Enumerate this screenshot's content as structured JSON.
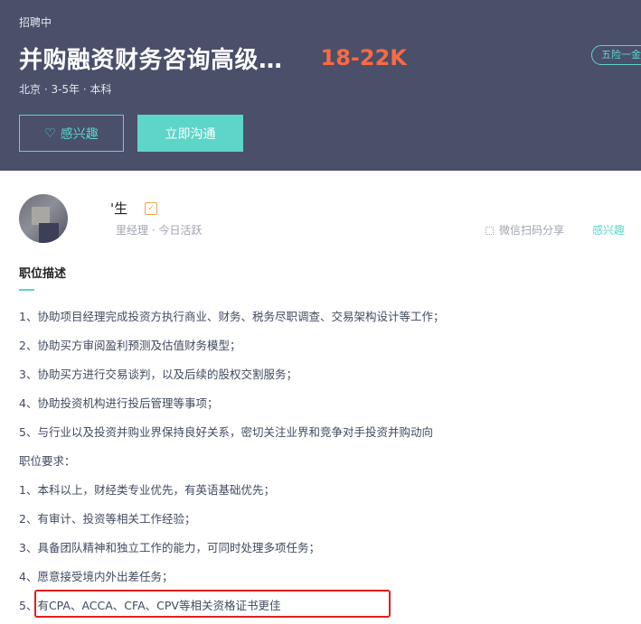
{
  "header": {
    "status": "招聘中",
    "title": "并购融资财务咨询高级…",
    "salary": "18-22K",
    "benefit_tag": "五险一金",
    "meta": "北京 · 3-5年 · 本科",
    "interest_label": "感兴趣",
    "chat_label": "立即沟通"
  },
  "recruiter": {
    "name": "'生",
    "verified_glyph": "✓",
    "meta": "里经理 · 今日活跃",
    "share_label": "微信扫码分享",
    "interest_label": "感兴趣"
  },
  "description": {
    "section_title": "职位描述",
    "lines": [
      "1、协助项目经理完成投资方执行商业、财务、税务尽职调查、交易架构设计等工作；",
      "2、协助买方审阅盈利预测及估值财务模型；",
      "3、协助买方进行交易谈判，以及后续的股权交割服务；",
      "4、协助投资机构进行投后管理等事项；",
      "5、与行业以及投资并购业界保持良好关系，密切关注业界和竞争对手投资并购动向",
      "职位要求：",
      "1、本科以上，财经类专业优先，有英语基础优先；",
      "2、有审计、投资等相关工作经验；",
      "3、具备团队精神和独立工作的能力，可同时处理多项任务；",
      "4、愿意接受境内外出差任务；",
      "5、有CPA、ACCA、CFA、CPV等相关资格证书更佳"
    ]
  },
  "colors": {
    "header_bg": "#4a4f6a",
    "accent": "#5dd5c8",
    "salary": "#fa6a43",
    "highlight": "#e41d1d"
  }
}
